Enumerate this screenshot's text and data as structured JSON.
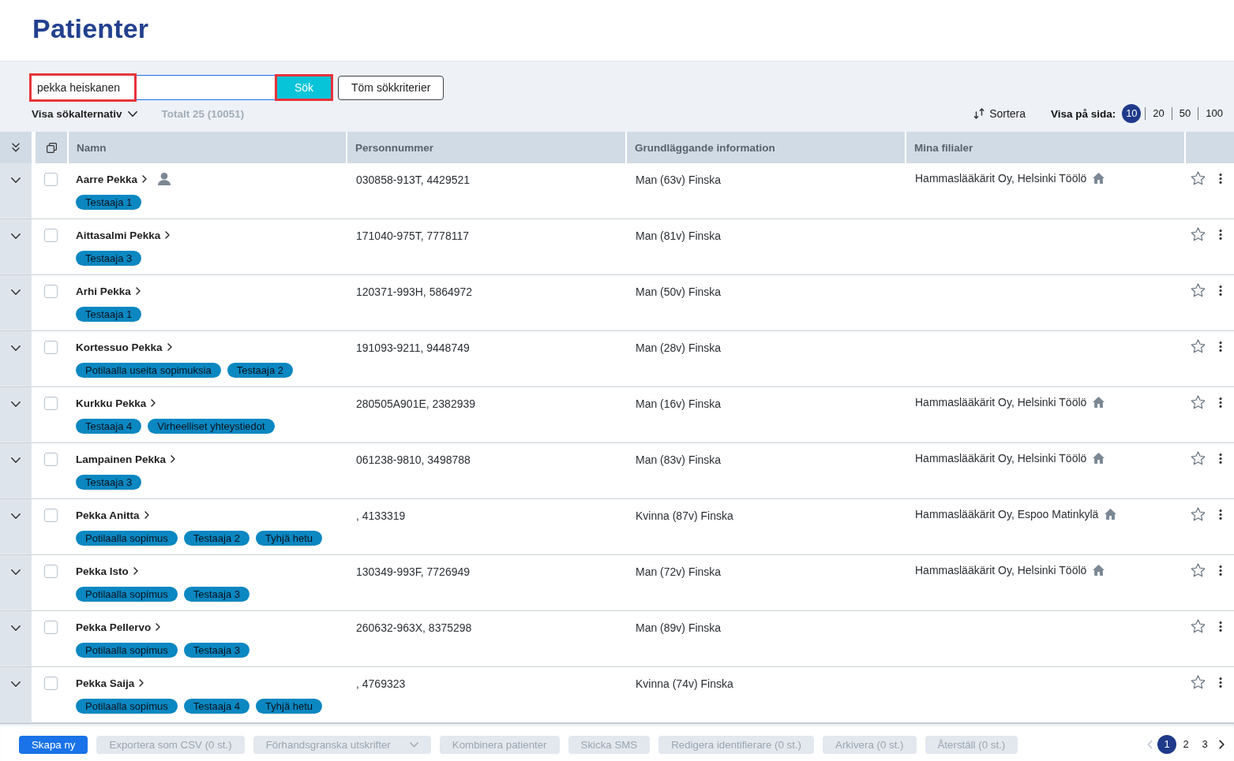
{
  "page": {
    "title": "Patienter"
  },
  "search": {
    "value": "pekka heiskanen",
    "highlighted": true
  },
  "search_button": {
    "label": "Sök",
    "highlighted": true
  },
  "clear_button": {
    "label": "Töm sökkriterier"
  },
  "search_options": {
    "label": "Visa sökalternativ",
    "expanded": false
  },
  "total": "Totalt 25 (10051)",
  "sort": {
    "label": "Sortera"
  },
  "page_size": {
    "label": "Visa på sida:",
    "options": [
      {
        "label": "10",
        "selected": true
      },
      {
        "label": "20",
        "selected": false
      },
      {
        "label": "50",
        "selected": false
      },
      {
        "label": "100",
        "selected": false
      }
    ]
  },
  "table": {
    "columns": [
      "Namn",
      "Personnummer",
      "Grundläggande information",
      "Mina filialer"
    ],
    "rows": [
      {
        "name": "Aarre Pekka",
        "user_icon": true,
        "expanded": false,
        "checked": false,
        "starred": false,
        "tags": [
          "Testaaja 1"
        ],
        "personnummer": "030858-913T, 4429521",
        "info": "Man (63v) Finska",
        "branch": "Hammaslääkärit Oy, Helsinki Töölö"
      },
      {
        "name": "Aittasalmi Pekka",
        "user_icon": false,
        "expanded": false,
        "checked": false,
        "starred": false,
        "tags": [
          "Testaaja 3"
        ],
        "personnummer": "171040-975T, 7778117",
        "info": "Man (81v) Finska"
      },
      {
        "name": "Arhi Pekka",
        "user_icon": false,
        "expanded": false,
        "checked": false,
        "starred": false,
        "tags": [
          "Testaaja 1"
        ],
        "personnummer": "120371-993H, 5864972",
        "info": "Man (50v) Finska"
      },
      {
        "name": "Kortessuo Pekka",
        "user_icon": false,
        "expanded": false,
        "checked": false,
        "starred": false,
        "tags": [
          "Potilaalla useita sopimuksia",
          "Testaaja 2"
        ],
        "personnummer": "191093-9211, 9448749",
        "info": "Man (28v) Finska"
      },
      {
        "name": "Kurkku Pekka",
        "user_icon": false,
        "expanded": false,
        "checked": false,
        "starred": false,
        "tags": [
          "Testaaja 4",
          "Virheelliset yhteystiedot"
        ],
        "personnummer": "280505A901E, 2382939",
        "info": "Man (16v) Finska",
        "branch": "Hammaslääkärit Oy, Helsinki Töölö"
      },
      {
        "name": "Lampainen Pekka",
        "user_icon": false,
        "expanded": false,
        "checked": false,
        "starred": false,
        "tags": [
          "Testaaja 3"
        ],
        "personnummer": "061238-9810, 3498788",
        "info": "Man (83v) Finska",
        "branch": "Hammaslääkärit Oy, Helsinki Töölö"
      },
      {
        "name": "Pekka Anitta",
        "user_icon": false,
        "expanded": false,
        "checked": false,
        "starred": false,
        "tags": [
          "Potilaalla sopimus",
          "Testaaja 2",
          "Tyhjä hetu"
        ],
        "personnummer": ", 4133319",
        "info": "Kvinna (87v) Finska",
        "branch": "Hammaslääkärit Oy, Espoo Matinkylä"
      },
      {
        "name": "Pekka Isto",
        "user_icon": false,
        "expanded": false,
        "checked": false,
        "starred": false,
        "tags": [
          "Potilaalla sopimus",
          "Testaaja 3"
        ],
        "personnummer": "130349-993F, 7726949",
        "info": "Man (72v) Finska",
        "branch": "Hammaslääkärit Oy, Helsinki Töölö"
      },
      {
        "name": "Pekka Pellervo",
        "user_icon": false,
        "expanded": false,
        "checked": false,
        "starred": false,
        "tags": [
          "Potilaalla sopimus",
          "Testaaja 3"
        ],
        "personnummer": "260632-963X, 8375298",
        "info": "Man (89v) Finska"
      },
      {
        "name": "Pekka Saija",
        "user_icon": false,
        "expanded": false,
        "checked": false,
        "starred": false,
        "tags": [
          "Potilaalla sopimus",
          "Testaaja 4",
          "Tyhjä hetu"
        ],
        "personnummer": ", 4769323",
        "info": "Kvinna (74v) Finska"
      }
    ]
  },
  "actions": [
    {
      "label": "Skapa ny",
      "kind": "primary",
      "disabled": false
    },
    {
      "label": "Exportera som CSV (0 st.)",
      "kind": "button",
      "disabled": true
    },
    {
      "label": "Förhandsgranska utskrifter",
      "kind": "dropdown",
      "disabled": true
    },
    {
      "label": "Kombinera patienter",
      "kind": "button",
      "disabled": true
    },
    {
      "label": "Skicka SMS",
      "kind": "button",
      "disabled": true
    },
    {
      "label": "Redigera identifierare (0 st.)",
      "kind": "button",
      "disabled": true
    },
    {
      "label": "Arkivera (0 st.)",
      "kind": "button",
      "disabled": true
    },
    {
      "label": "Återställ (0 st.)",
      "kind": "button",
      "disabled": true
    }
  ],
  "pagination": {
    "previous": {
      "disabled": true
    },
    "pages": [
      {
        "label": "1",
        "selected": true
      },
      {
        "label": "2",
        "selected": false
      },
      {
        "label": "3",
        "selected": false
      }
    ],
    "next": {
      "disabled": false
    }
  }
}
